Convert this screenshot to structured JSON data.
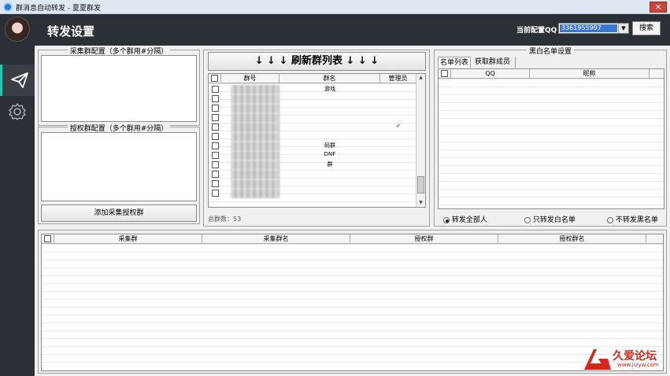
{
  "window": {
    "title": "群消息自动转发 - 夏夏群发",
    "close_label": "×"
  },
  "header": {
    "page_title": "转发设置",
    "config_label": "当前配置QQ",
    "qq_value": "3361955997",
    "search_label": "搜索"
  },
  "sidebar": {
    "items": [
      {
        "icon": "paper-plane-icon",
        "active": true
      },
      {
        "icon": "gear-icon",
        "active": false
      }
    ]
  },
  "collect": {
    "legend": "采集群配置（多个群用#分隔）",
    "value": ""
  },
  "auth": {
    "legend": "授权群配置（多个群用#分隔）",
    "value": "",
    "add_button": "添加采集授权群"
  },
  "groups": {
    "refresh_button": "↓ ↓ ↓ 刷新群列表 ↓ ↓ ↓",
    "columns": [
      "群号",
      "群名",
      "管理员"
    ],
    "rows": [
      {
        "name": "游戏",
        "admin": ""
      },
      {
        "name": "",
        "admin": ""
      },
      {
        "name": "",
        "admin": ""
      },
      {
        "name": "",
        "admin": ""
      },
      {
        "name": "",
        "admin": "✓"
      },
      {
        "name": "",
        "admin": ""
      },
      {
        "name": "码群",
        "admin": ""
      },
      {
        "name": "DNF",
        "admin": ""
      },
      {
        "name": "群",
        "admin": ""
      },
      {
        "name": "",
        "admin": ""
      },
      {
        "name": "",
        "admin": ""
      },
      {
        "name": "",
        "admin": ""
      }
    ],
    "total_label": "总群数：53"
  },
  "bw": {
    "legend": "黑白名单设置",
    "tabs": [
      "名单列表",
      "获取群成员"
    ],
    "columns": [
      "QQ",
      "昵称"
    ],
    "radios": [
      {
        "label": "转发全部人",
        "checked": true
      },
      {
        "label": "只转发白名单",
        "checked": false
      },
      {
        "label": "不转发黑名单",
        "checked": false
      }
    ]
  },
  "bottom": {
    "columns": [
      "采集群",
      "采集群名",
      "授权群",
      "授权群名"
    ]
  },
  "watermark": {
    "brand": "久爱论坛",
    "url": "www.jizyw.com"
  },
  "colors": {
    "header_bg": "#2b2f36",
    "accent": "#26c7b0",
    "selection": "#3a78d8"
  }
}
